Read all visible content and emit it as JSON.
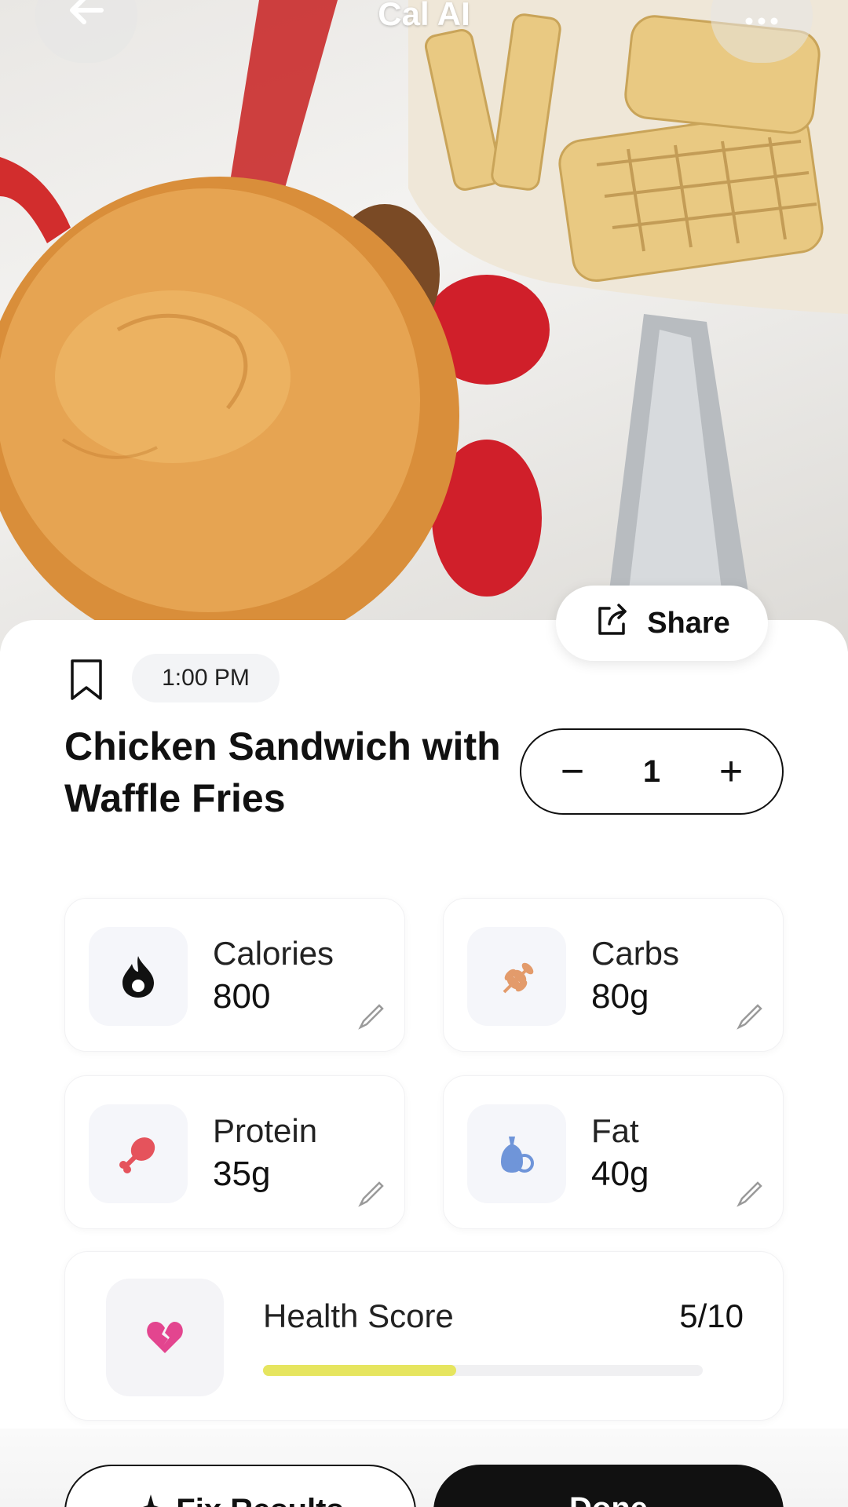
{
  "app": {
    "title": "Cal AI"
  },
  "top_bar": {
    "back_icon": "arrow-left-icon",
    "more_icon": "more-horizontal-icon"
  },
  "share": {
    "label": "Share",
    "icon": "share-icon"
  },
  "meal": {
    "bookmark_icon": "bookmark-icon",
    "time": "1:00 PM",
    "title": "Chicken Sandwich with Waffle Fries",
    "quantity": "1",
    "minus_label": "−",
    "plus_label": "+"
  },
  "nutrients": [
    {
      "label": "Calories",
      "value": "800",
      "icon": "flame-icon",
      "icon_color": "#111111"
    },
    {
      "label": "Carbs",
      "value": "80g",
      "icon": "wheat-icon",
      "icon_color": "#e39b6b"
    },
    {
      "label": "Protein",
      "value": "35g",
      "icon": "drumstick-icon",
      "icon_color": "#e5535c"
    },
    {
      "label": "Fat",
      "value": "40g",
      "icon": "oil-drop-icon",
      "icon_color": "#6f95d9"
    }
  ],
  "health": {
    "label": "Health Score",
    "score": "5/10",
    "fraction": 0.44,
    "icon": "broken-heart-icon",
    "icon_color": "#e3458f",
    "bar_color": "#e6e55f"
  },
  "footer": {
    "fix_label": "Fix Results",
    "fix_icon": "sparkle-icon",
    "done_label": "Done"
  }
}
